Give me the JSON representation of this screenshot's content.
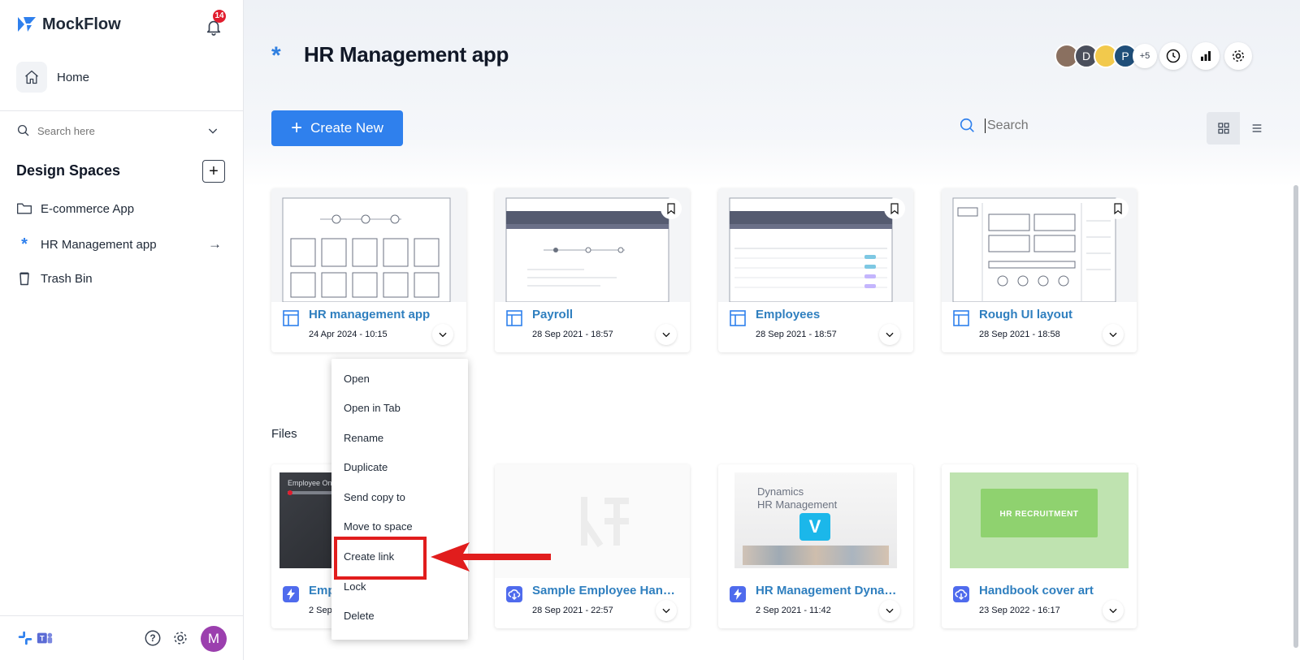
{
  "sidebar": {
    "logo_text": "MockFlow",
    "notification_count": "14",
    "home_label": "Home",
    "search_placeholder": "Search here",
    "design_spaces_title": "Design Spaces",
    "items": [
      {
        "label": "E-commerce App",
        "icon": "folder-icon"
      },
      {
        "label": "HR Management app",
        "icon": "asterisk-icon"
      },
      {
        "label": "Trash Bin",
        "icon": "trash-icon"
      }
    ],
    "user_initial": "M"
  },
  "header": {
    "title": "HR Management app",
    "collaborators": [
      "",
      "D",
      "",
      "P"
    ],
    "more_count": "+5"
  },
  "toolbar": {
    "create_label": "Create New",
    "search_placeholder": "Search"
  },
  "projects": [
    {
      "title": "HR management app",
      "date": "24 Apr 2024 - 10:15"
    },
    {
      "title": "Payroll",
      "date": "28 Sep 2021 - 18:57"
    },
    {
      "title": "Employees",
      "date": "28 Sep 2021 - 18:57"
    },
    {
      "title": "Rough UI layout",
      "date": "28 Sep 2021 - 18:58"
    }
  ],
  "files_label": "Files",
  "files": [
    {
      "title": "Emp",
      "date": "2 Sep",
      "thumb_text": "Employee Onbo"
    },
    {
      "title": "Sample Employee Hand…",
      "date": "28 Sep 2021 - 22:57"
    },
    {
      "title": "HR Management Dyna…",
      "date": "2 Sep 2021 - 11:42",
      "thumb_line1": "Dynamics",
      "thumb_line2": "HR Management"
    },
    {
      "title": "Handbook cover art",
      "date": "23 Sep 2022 - 16:17",
      "thumb_text": "HR RECRUITMENT"
    }
  ],
  "context_menu": {
    "items": [
      "Open",
      "Open in Tab",
      "Rename",
      "Duplicate",
      "Send copy to",
      "Move to space",
      "Create link",
      "Lock",
      "Delete"
    ],
    "highlighted": "Create link"
  },
  "colors": {
    "accent": "#2f80ed",
    "title_link": "#2f7fbf",
    "highlight": "#e11d1d",
    "avatar_m": "#9b3fae"
  }
}
